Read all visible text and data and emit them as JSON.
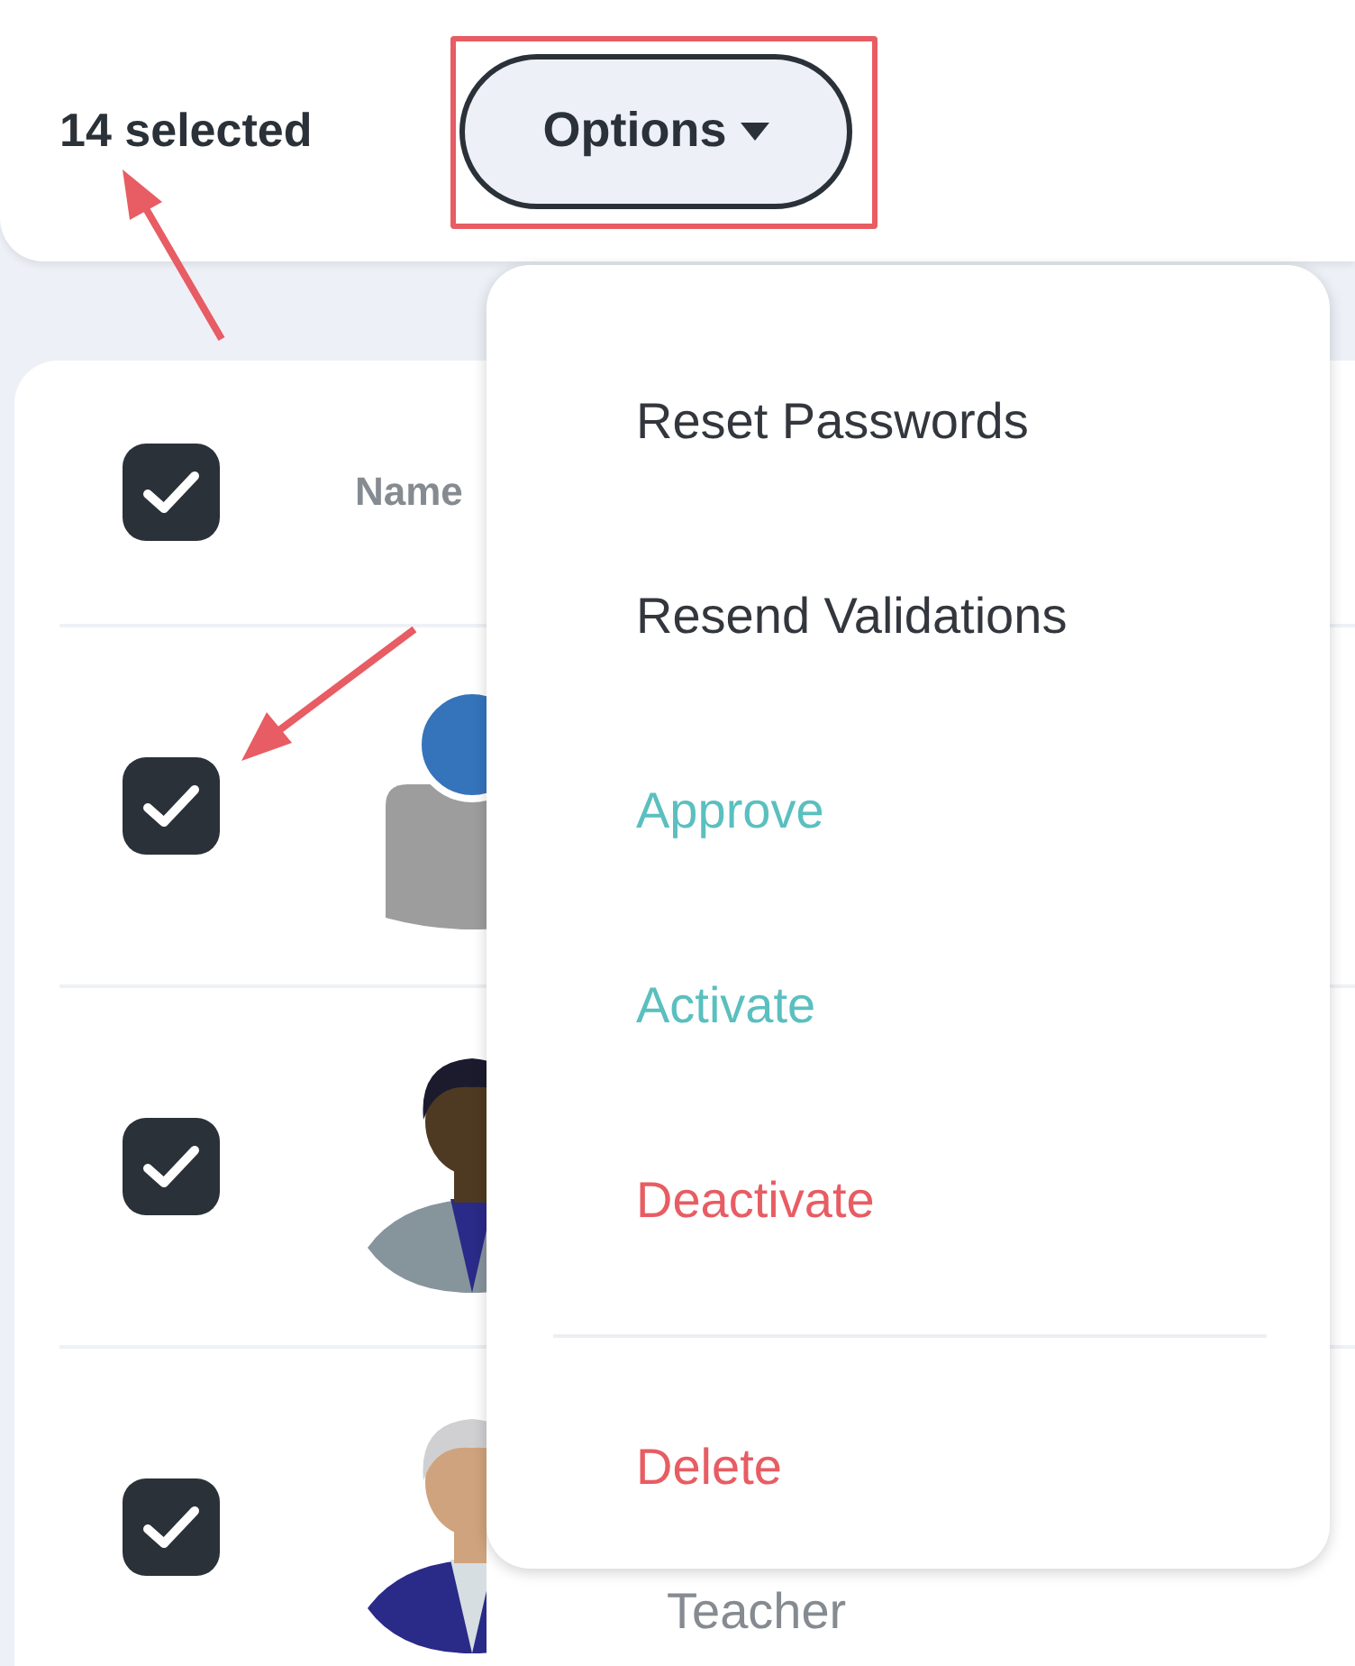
{
  "toolbar": {
    "selection_count": "14 selected",
    "options_button": "Options"
  },
  "table": {
    "header": {
      "checked": true,
      "column_name": "Name"
    },
    "rows": [
      {
        "kind": "placeholder",
        "checked": true
      },
      {
        "kind": "person",
        "checked": true
      },
      {
        "kind": "person",
        "checked": true,
        "role": "Teacher"
      }
    ]
  },
  "menu": {
    "items": [
      {
        "kind": "default",
        "label": "Reset Passwords"
      },
      {
        "kind": "default",
        "label": "Resend Validations"
      },
      {
        "kind": "positive",
        "label": "Approve"
      },
      {
        "kind": "positive",
        "label": "Activate"
      },
      {
        "kind": "danger",
        "label": "Deactivate"
      },
      {
        "kind": "divider"
      },
      {
        "kind": "danger",
        "label": "Delete"
      }
    ]
  }
}
